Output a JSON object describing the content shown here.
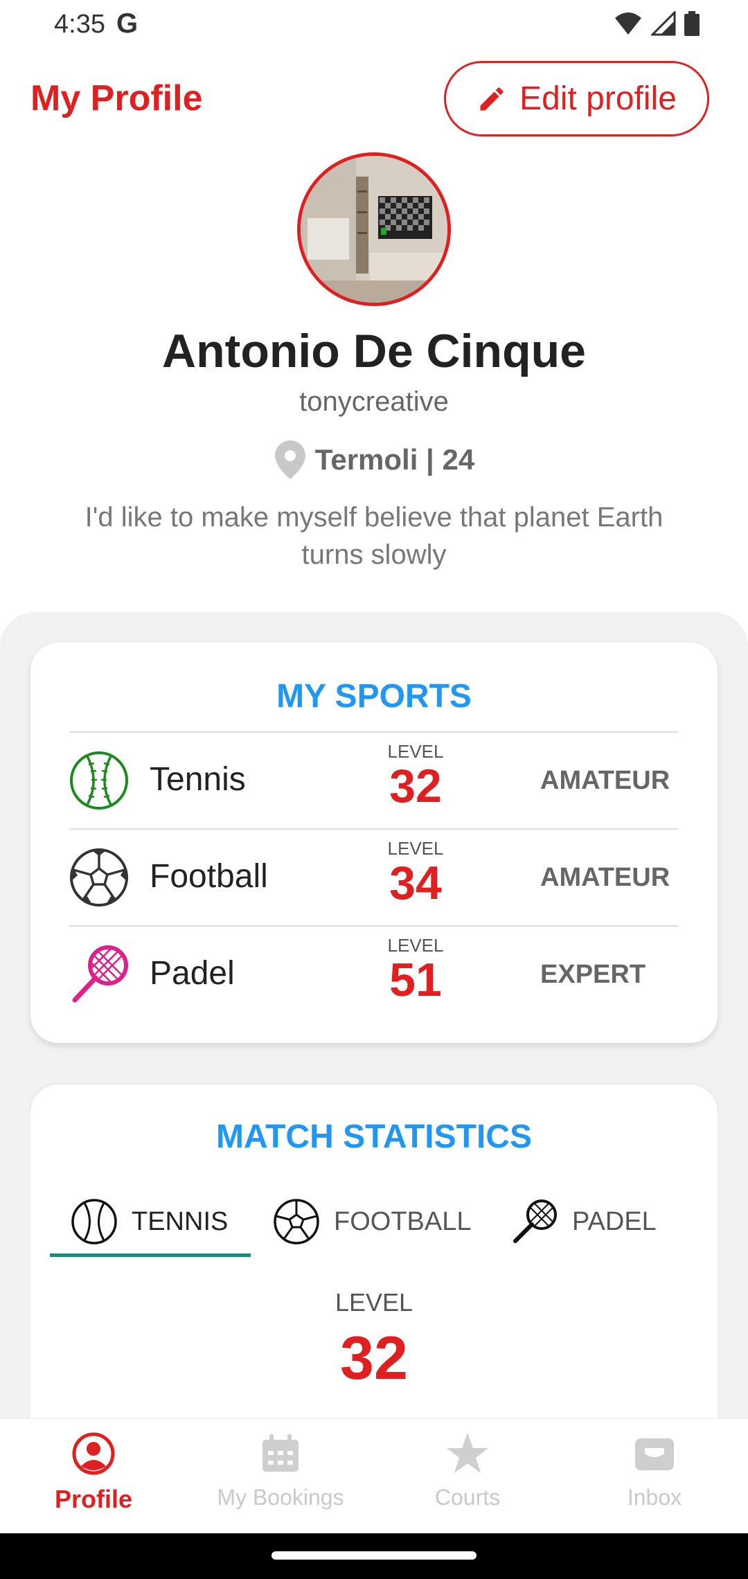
{
  "status_bar": {
    "time": "4:35",
    "g_logo": "G"
  },
  "header": {
    "title": "My Profile",
    "edit_label": "Edit profile"
  },
  "profile": {
    "name": "Antonio De Cinque",
    "username": "tonycreative",
    "location": "Termoli | 24",
    "bio": "I'd like to make myself believe that planet Earth turns slowly"
  },
  "sports": {
    "title": "MY SPORTS",
    "items": [
      {
        "name": "Tennis",
        "level_label": "LEVEL",
        "level": "32",
        "rank": "AMATEUR",
        "icon": "tennis-ball-icon",
        "color": "#1a8a1a"
      },
      {
        "name": "Football",
        "level_label": "LEVEL",
        "level": "34",
        "rank": "AMATEUR",
        "icon": "football-icon",
        "color": "#333333"
      },
      {
        "name": "Padel",
        "level_label": "LEVEL",
        "level": "51",
        "rank": "EXPERT",
        "icon": "padel-racket-icon",
        "color": "#e0208a"
      }
    ]
  },
  "stats": {
    "title": "MATCH STATISTICS",
    "tabs": [
      {
        "label": "TENNIS",
        "active": true
      },
      {
        "label": "FOOTBALL",
        "active": false
      },
      {
        "label": "PADEL",
        "active": false
      }
    ],
    "level_label": "LEVEL",
    "level": "32"
  },
  "nav": {
    "items": [
      {
        "label": "Profile",
        "icon": "profile-icon",
        "active": true
      },
      {
        "label": "My Bookings",
        "icon": "calendar-icon",
        "active": false
      },
      {
        "label": "Courts",
        "icon": "star-icon",
        "active": false
      },
      {
        "label": "Inbox",
        "icon": "inbox-icon",
        "active": false
      }
    ]
  },
  "colors": {
    "accent": "#e02020",
    "title_blue": "#2196f3",
    "tab_indicator": "#1a8a7a"
  }
}
